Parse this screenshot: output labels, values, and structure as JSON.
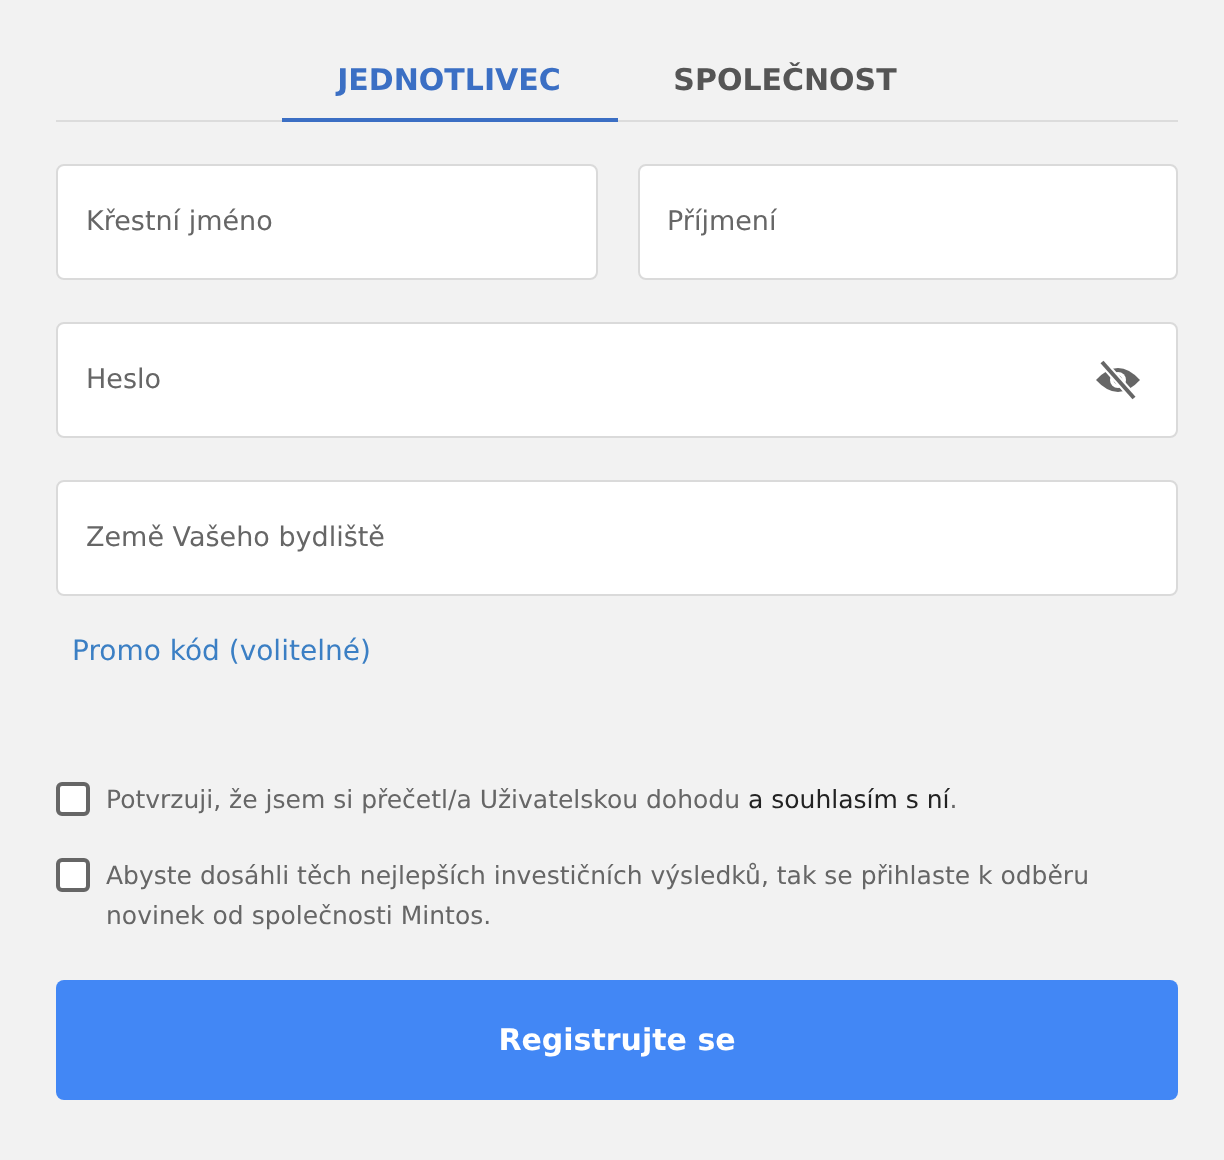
{
  "tabs": [
    {
      "label": "JEDNOTLIVEC",
      "selected": true
    },
    {
      "label": "SPOLEČNOST",
      "selected": false
    }
  ],
  "name_fields": [
    {
      "placeholder": "Křestní jméno"
    },
    {
      "placeholder": "Příjmení"
    }
  ],
  "password_field": {
    "placeholder": "Heslo",
    "visible": false
  },
  "country_field": {
    "placeholder": "Země Vašeho bydliště"
  },
  "promo_link": "Promo kód (volitelné)",
  "consents": [
    {
      "text": "Potvrzuji, že jsem si přečetl/a Uživatelskou dohodu ",
      "text_dark": "a souhlasím s ní",
      "text_end": ".",
      "checked": false
    },
    {
      "text": "Abyste dosáhli těch nejlepších investičních výsledků, tak se přihlaste k odběru novinek od společnosti Mintos.",
      "checked": false
    }
  ],
  "submit_button": "Registrujte se"
}
